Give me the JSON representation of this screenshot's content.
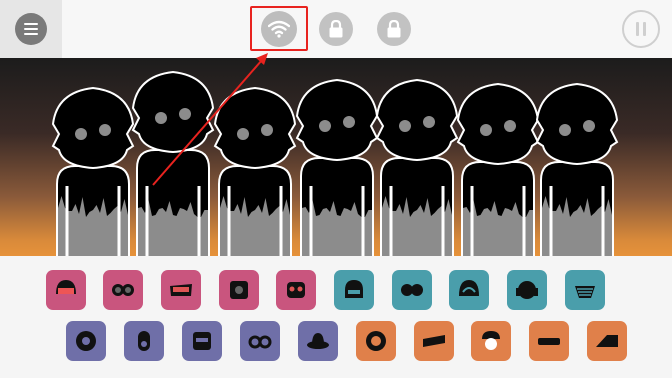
{
  "topbar": {
    "menu_icon": "hamburger-menu-icon",
    "center_buttons": [
      {
        "icon": "wifi-icon",
        "state": "active"
      },
      {
        "icon": "lock-icon",
        "state": "locked"
      },
      {
        "icon": "lock-icon",
        "state": "locked"
      }
    ],
    "pause_icon": "pause-icon"
  },
  "stage": {
    "character_count": 7
  },
  "sound_palette": {
    "row_1": [
      {
        "icon": "helmet-visor-icon",
        "color": "#c9557e"
      },
      {
        "icon": "goggles-icon",
        "color": "#c9557e"
      },
      {
        "icon": "visor-icon",
        "color": "#c9557e"
      },
      {
        "icon": "gear-box-icon",
        "color": "#c9557e"
      },
      {
        "icon": "robot-face-icon",
        "color": "#c9557e"
      },
      {
        "icon": "masked-face-icon",
        "color": "#4a9eab"
      },
      {
        "icon": "round-goggles-icon",
        "color": "#4a9eab"
      },
      {
        "icon": "wave-head-icon",
        "color": "#4a9eab"
      },
      {
        "icon": "headphones-icon",
        "color": "#4a9eab"
      },
      {
        "icon": "mesh-mask-icon",
        "color": "#4a9eab"
      }
    ],
    "row_2": [
      {
        "icon": "gear-ball-icon",
        "color": "#6f6fa8"
      },
      {
        "icon": "capsule-icon",
        "color": "#6f6fa8"
      },
      {
        "icon": "box-head-icon",
        "color": "#6f6fa8"
      },
      {
        "icon": "glasses-icon",
        "color": "#6f6fa8"
      },
      {
        "icon": "hat-icon",
        "color": "#6f6fa8"
      },
      {
        "icon": "speaker-icon",
        "color": "#e0804a"
      },
      {
        "icon": "tilted-visor-icon",
        "color": "#e0804a"
      },
      {
        "icon": "cap-face-icon",
        "color": "#e0804a"
      },
      {
        "icon": "flat-bar-icon",
        "color": "#e0804a"
      },
      {
        "icon": "ramp-icon",
        "color": "#e0804a"
      }
    ]
  },
  "highlight_color": "#e8231f"
}
